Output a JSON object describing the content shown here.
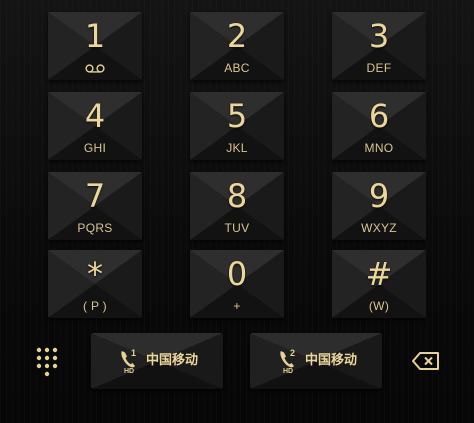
{
  "keys": [
    {
      "digit": "1",
      "letters": "",
      "icon": "voicemail-icon"
    },
    {
      "digit": "2",
      "letters": "ABC"
    },
    {
      "digit": "3",
      "letters": "DEF"
    },
    {
      "digit": "4",
      "letters": "GHI"
    },
    {
      "digit": "5",
      "letters": "JKL"
    },
    {
      "digit": "6",
      "letters": "MNO"
    },
    {
      "digit": "7",
      "letters": "PQRS"
    },
    {
      "digit": "8",
      "letters": "TUV"
    },
    {
      "digit": "9",
      "letters": "WXYZ"
    },
    {
      "digit": "*",
      "letters": "( P )"
    },
    {
      "digit": "0",
      "letters": "+"
    },
    {
      "digit": "#",
      "letters": "(W)"
    }
  ],
  "bottom_bar": {
    "dialpad_icon": "dialpad-grid-icon",
    "sim1": {
      "sim_number": "1",
      "hd_label": "HD",
      "carrier": "中国移动",
      "icon": "phone-sim1-icon"
    },
    "sim2": {
      "sim_number": "2",
      "hd_label": "HD",
      "carrier": "中国移动",
      "icon": "phone-sim2-icon"
    },
    "backspace_icon": "backspace-icon"
  },
  "colors": {
    "gold": "#ecd79a",
    "background": "#0b0b0b",
    "key_face": "#1c1c1c"
  }
}
